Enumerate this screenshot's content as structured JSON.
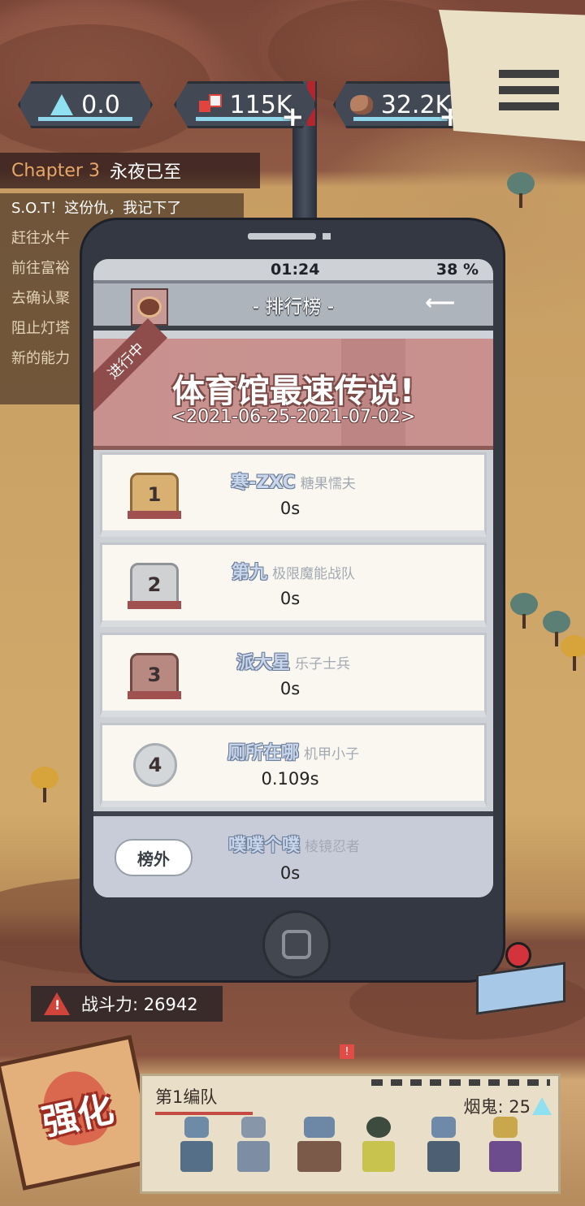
{
  "resources": {
    "crystal": {
      "icon": "crystal-icon",
      "value": "0.0"
    },
    "blood": {
      "icon": "blood-icon",
      "value": "115K"
    },
    "stone": {
      "icon": "stone-icon",
      "value": "32.2K"
    },
    "plus_symbol": "+"
  },
  "chapter": {
    "number": "Chapter 3",
    "name": "永夜已至"
  },
  "quests": [
    "S.O.T！这份仇，我记下了",
    "赶往水牛",
    "前往富裕",
    "去确认聚",
    "阻止灯塔",
    "新的能力"
  ],
  "phone": {
    "status": {
      "time": "01:24",
      "battery": "38 %"
    },
    "title": "- 排行榜 -",
    "back_symbol": "⟵",
    "event": {
      "ribbon": "进行中",
      "title": "体育馆最速传说!",
      "date": "<2021-06-25-2021-07-02>"
    },
    "rankings": [
      {
        "rank": "1",
        "name": "寒-ZXC",
        "title": "糖果懦夫",
        "time": "0s"
      },
      {
        "rank": "2",
        "name": "第九",
        "title": "极限魔能战队",
        "time": "0s"
      },
      {
        "rank": "3",
        "name": "派大星",
        "title": "乐子士兵",
        "time": "0s"
      },
      {
        "rank": "4",
        "name": "厕所在哪",
        "title": "机甲小子",
        "time": "0.109s"
      }
    ],
    "self": {
      "tag": "榜外",
      "name": "噗噗个噗",
      "title": "棱镜忍者",
      "time": "0s"
    }
  },
  "hud": {
    "power_label": "战斗力: 26942",
    "enhance_label": "强化",
    "team_name": "第1编队",
    "smoke_label": "烟鬼: 25",
    "notice_symbol": "!"
  },
  "colors": {
    "event_banner": "#c9918e",
    "phone_body": "#343843",
    "accent_cyan": "#8fe0f0",
    "quest_highlight": "#e7a767"
  }
}
